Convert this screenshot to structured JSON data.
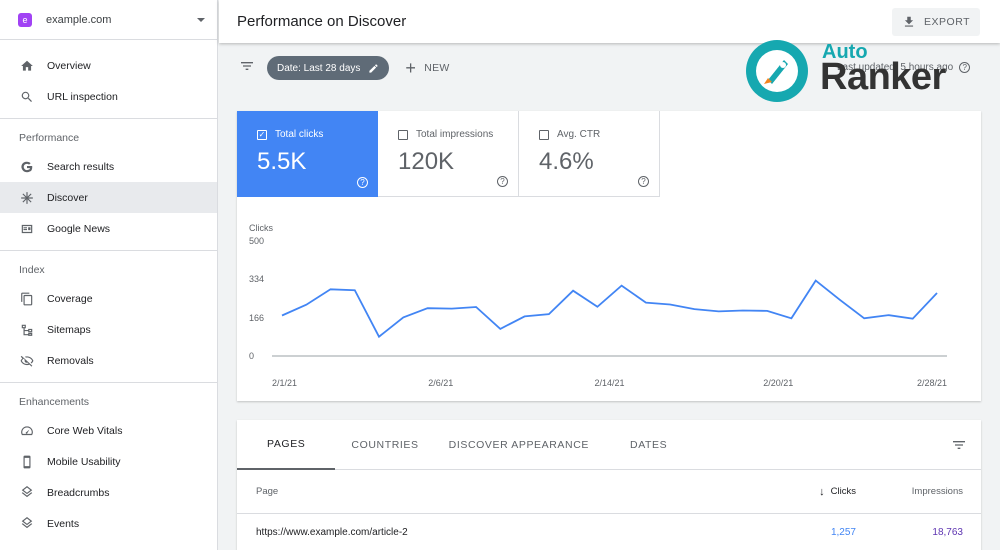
{
  "sidebar": {
    "property": {
      "icon_letter": "e",
      "name": "example.com"
    },
    "top_items": [
      {
        "label": "Overview",
        "icon": "home-icon"
      },
      {
        "label": "URL inspection",
        "icon": "search-icon"
      }
    ],
    "performance": {
      "label": "Performance",
      "items": [
        {
          "label": "Search results",
          "icon": "google-g-icon"
        },
        {
          "label": "Discover",
          "icon": "asterisk-icon"
        },
        {
          "label": "Google News",
          "icon": "news-icon"
        }
      ]
    },
    "index": {
      "label": "Index",
      "items": [
        {
          "label": "Coverage",
          "icon": "copy-icon"
        },
        {
          "label": "Sitemaps",
          "icon": "sitemap-icon"
        },
        {
          "label": "Removals",
          "icon": "eye-off-icon"
        }
      ]
    },
    "enhancements": {
      "label": "Enhancements",
      "items": [
        {
          "label": "Core Web Vitals",
          "icon": "speed-icon"
        },
        {
          "label": "Mobile Usability",
          "icon": "phone-icon"
        },
        {
          "label": "Breadcrumbs",
          "icon": "layers-icon"
        },
        {
          "label": "Events",
          "icon": "layers-icon"
        }
      ]
    }
  },
  "header": {
    "title": "Performance on Discover",
    "export_label": "EXPORT"
  },
  "filterbar": {
    "date_chip": "Date: Last 28 days",
    "new_label": "NEW",
    "updated_text": "Last updated: 5 hours ago"
  },
  "logo": {
    "line1": "Auto",
    "line2": "Ranker"
  },
  "metrics": [
    {
      "label": "Total clicks",
      "value": "5.5K",
      "selected": true
    },
    {
      "label": "Total impressions",
      "value": "120K",
      "selected": false
    },
    {
      "label": "Avg. CTR",
      "value": "4.6%",
      "selected": false
    }
  ],
  "chart_data": {
    "type": "line",
    "ylabel": "Clicks",
    "ylim": [
      0,
      500
    ],
    "yticks": [
      "500",
      "334",
      "166",
      "0"
    ],
    "xtick_labels": [
      "2/1/21",
      "2/6/21",
      "2/14/21",
      "2/20/21",
      "2/28/21"
    ],
    "color": "#4285f4",
    "series": [
      {
        "values": [
          176,
          223,
          290,
          286,
          84,
          168,
          208,
          206,
          213,
          118,
          172,
          182,
          284,
          214,
          306,
          232,
          224,
          204,
          194,
          198,
          196,
          164,
          328,
          244,
          164,
          178,
          162,
          274
        ]
      }
    ],
    "grid": "horizontal"
  },
  "table": {
    "tabs": [
      "PAGES",
      "COUNTRIES",
      "DISCOVER APPEARANCE",
      "DATES"
    ],
    "columns": {
      "page": "Page",
      "clicks": "Clicks",
      "impressions": "Impressions"
    },
    "rows": [
      {
        "page": "https://www.example.com/article-2",
        "clicks": "1,257",
        "impressions": "18,763"
      }
    ]
  }
}
